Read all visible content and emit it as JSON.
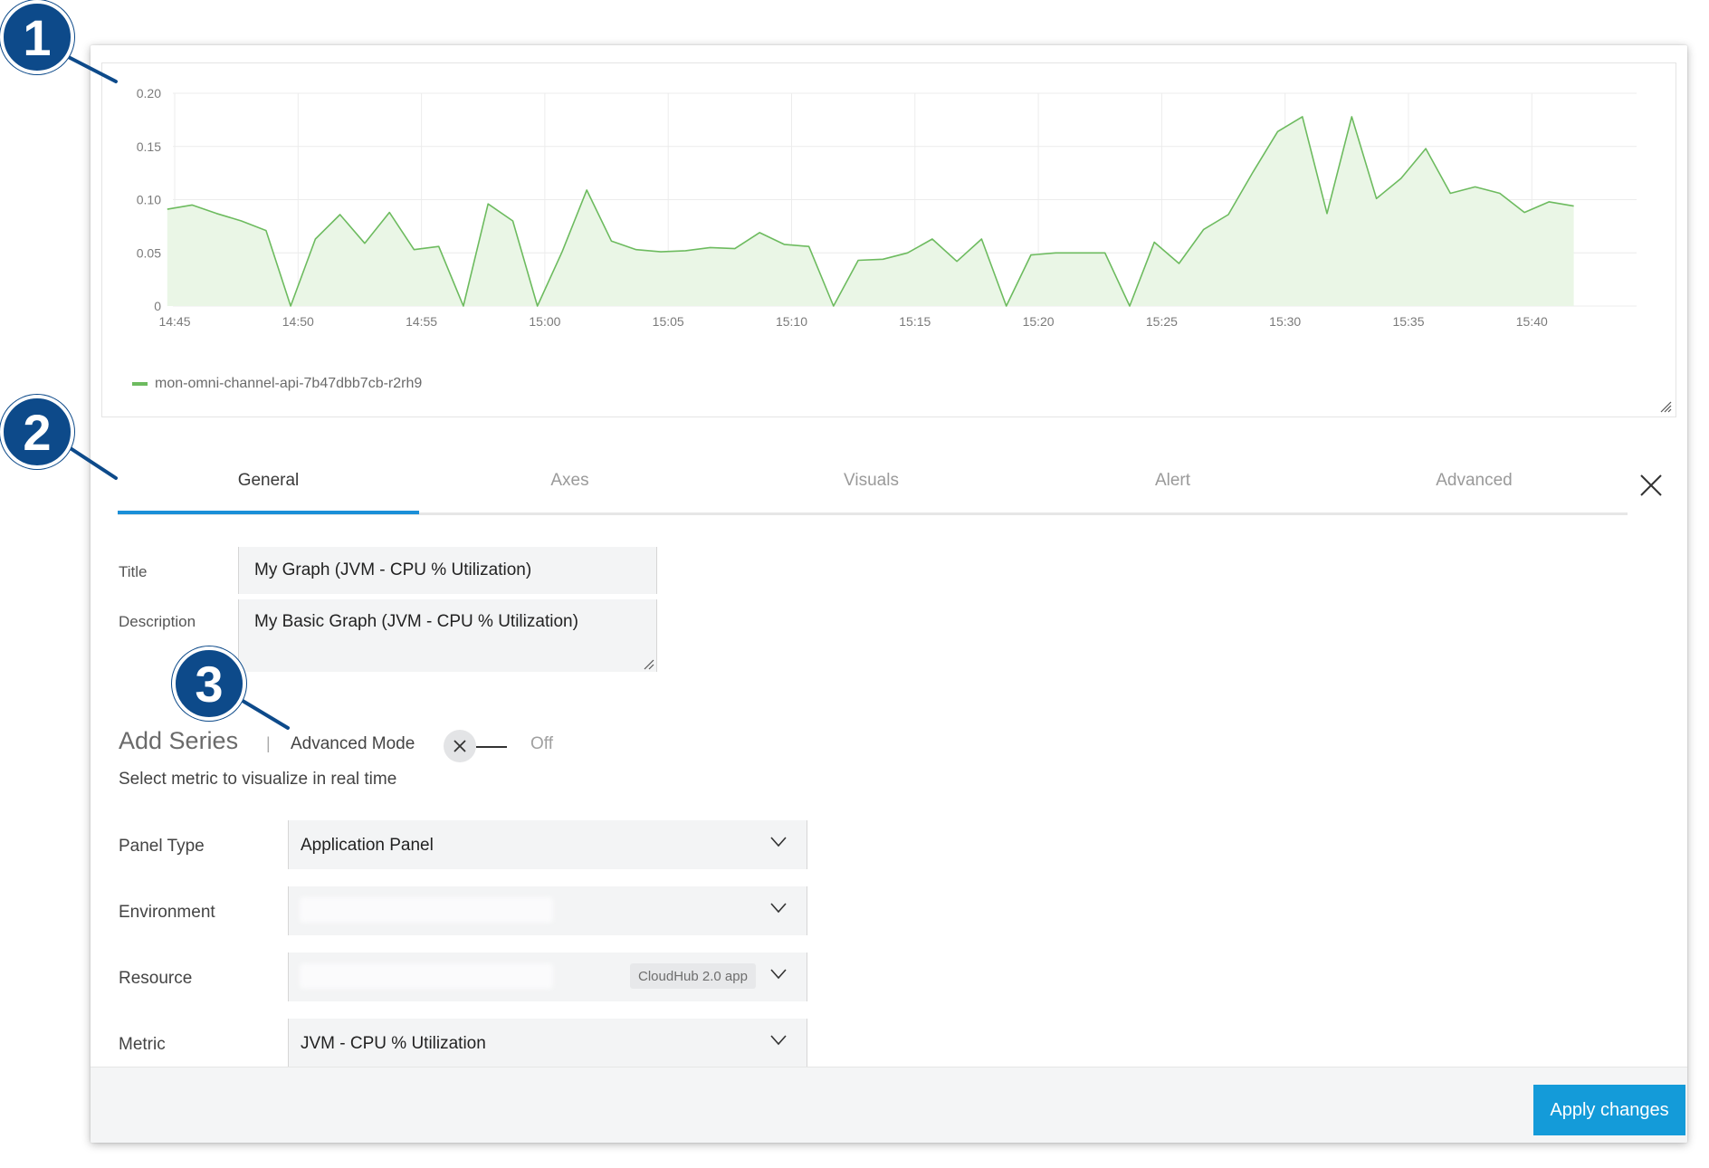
{
  "colors": {
    "series": "#6dbb5f",
    "series_fill": "#eaf6e6",
    "accent": "#1b8fd8",
    "apply_button": "#149bd9",
    "callout": "#0d4a8a"
  },
  "chart_data": {
    "type": "area",
    "x_tick_labels": [
      "14:45",
      "14:50",
      "14:55",
      "15:00",
      "15:05",
      "15:10",
      "15:15",
      "15:20",
      "15:25",
      "15:30",
      "15:35",
      "15:40"
    ],
    "y_tick_labels": [
      "0",
      "0.05",
      "0.10",
      "0.15",
      "0.20"
    ],
    "ylim": [
      0,
      0.2
    ],
    "x_minutes_from_start": [
      -0.3,
      0.7,
      1.7,
      2.7,
      3.7,
      4.7,
      5.7,
      6.7,
      7.7,
      8.7,
      9.7,
      10.7,
      11.7,
      12.7,
      13.7,
      14.7,
      15.7,
      16.7,
      17.7,
      18.7,
      19.7,
      20.7,
      21.7,
      22.7,
      23.7,
      24.7,
      25.7,
      26.7,
      27.7,
      28.7,
      29.7,
      30.7,
      31.7,
      32.7,
      33.7,
      34.7,
      35.7,
      36.7,
      37.7,
      38.7,
      39.7,
      40.7,
      41.7,
      42.7,
      43.7,
      44.7,
      45.7,
      46.7,
      47.7,
      48.7,
      49.7,
      50.7,
      51.7,
      52.7,
      53.7,
      54.7,
      55.7,
      56.7,
      57.7,
      58.7,
      59.7,
      60.7
    ],
    "series": [
      {
        "name": "mon-omni-channel-api-7b47dbb7cb-r2rh9",
        "values": [
          0.091,
          0.095,
          0.087,
          0.08,
          0.071,
          0.0,
          0.063,
          0.086,
          0.059,
          0.088,
          0.053,
          0.056,
          0.0,
          0.096,
          0.08,
          0.0,
          0.051,
          0.109,
          0.061,
          0.053,
          0.051,
          0.052,
          0.055,
          0.054,
          0.069,
          0.058,
          0.056,
          0.0,
          0.043,
          0.044,
          0.05,
          0.063,
          0.042,
          0.063,
          0.0,
          0.048,
          0.05,
          0.05,
          0.05,
          0.0,
          0.06,
          0.04,
          0.072,
          0.086,
          0.126,
          0.164,
          0.178,
          0.087,
          0.178,
          0.101,
          0.12,
          0.148,
          0.106,
          0.112,
          0.106,
          0.088,
          0.098,
          0.094
        ]
      }
    ],
    "grid": true,
    "legend": "bottom-left"
  },
  "tabs": [
    {
      "label": "General"
    },
    {
      "label": "Axes"
    },
    {
      "label": "Visuals"
    },
    {
      "label": "Alert"
    },
    {
      "label": "Advanced"
    }
  ],
  "form": {
    "title_label": "Title",
    "title_value": "My Graph (JVM - CPU % Utilization)",
    "description_label": "Description",
    "description_value": "My Basic Graph  (JVM - CPU % Utilization)"
  },
  "add_series": {
    "heading": "Add Series",
    "separator": "|",
    "advanced_mode_label": "Advanced Mode",
    "toggle_state": "Off",
    "hint": "Select metric to visualize in real time",
    "rows": [
      {
        "label": "Panel Type",
        "value": "Application Panel"
      },
      {
        "label": "Environment",
        "value": ""
      },
      {
        "label": "Resource",
        "value": "",
        "badge": "CloudHub 2.0 app"
      },
      {
        "label": "Metric",
        "value": "JVM - CPU % Utilization"
      }
    ]
  },
  "footer": {
    "apply_label": "Apply changes"
  },
  "callouts": [
    "1",
    "2",
    "3"
  ]
}
